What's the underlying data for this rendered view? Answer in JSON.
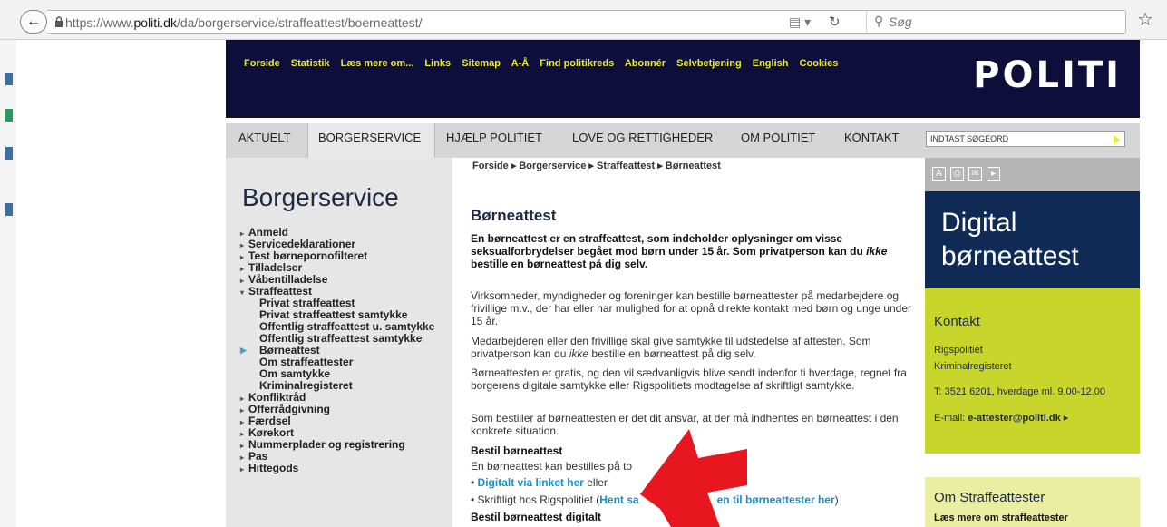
{
  "browser": {
    "url_prefix": "https://www.",
    "url_domain": "politi.dk",
    "url_path": "/da/borgerservice/straffeattest/boerneattest/",
    "search_placeholder": "Søg"
  },
  "header": {
    "topnav": [
      "Forside",
      "Statistik",
      "Læs mere om...",
      "Links",
      "Sitemap",
      "A-Å",
      "Find politikreds",
      "Abonnér",
      "Selvbetjening",
      "English",
      "Cookies"
    ],
    "logo": "POLITI"
  },
  "mainnav": {
    "items": [
      "AKTUELT",
      "BORGERSERVICE",
      "HJÆLP POLITIET",
      "LOVE OG RETTIGHEDER",
      "OM POLITIET",
      "KONTAKT"
    ],
    "search_placeholder": "INDTAST SØGEORD"
  },
  "sidebar": {
    "title": "Borgerservice",
    "items": [
      "Anmeld",
      "Servicedeklarationer",
      "Test børnepornofilteret",
      "Tilladelser",
      "Våbentilladelse",
      "Straffeattest"
    ],
    "subitems": [
      "Privat straffeattest",
      "Privat straffeattest samtykke",
      "Offentlig straffeattest u. samtykke",
      "Offentlig straffeattest samtykke",
      "Børneattest",
      "Om straffeattester",
      "Om samtykke",
      "Kriminalregisteret"
    ],
    "items_after": [
      "Konfliktråd",
      "Offerrådgivning",
      "Færdsel",
      "Kørekort",
      "Nummerplader og registrering",
      "Pas",
      "Hittegods"
    ]
  },
  "content": {
    "breadcrumb": "Forside ▸ Borgerservice ▸ Straffeattest ▸ Børneattest",
    "title": "Børneattest",
    "intro_1": "En børneattest er en straffeattest, som indeholder oplysninger om visse seksualforbrydelser begået mod børn under 15 år. Som privatperson kan du ",
    "intro_em": "ikke",
    "intro_2": " bestille en børneattest på dig selv.",
    "para1": "Virksomheder, myndigheder og foreninger kan bestille børneattester på medarbejdere og frivillige m.v., der har eller har mulighed for at opnå direkte kontakt med børn og unge under 15 år.",
    "para2_1": "Medarbejderen eller den frivillige skal give samtykke til udstedelse af attesten. Som privatperson kan du ",
    "para2_em": "ikke",
    "para2_2": " bestille en børneattest på dig selv.",
    "para3": "Børneattesten er gratis, og den vil sædvanligvis blive sendt indenfor ti hverdage, regnet fra borgerens digitale samtykke eller Rigspolitiets modtagelse af skriftligt samtykke.",
    "para4": "Som bestiller af børneattesten er det dit ansvar, at der må indhentes en børneattest i den konkrete situation.",
    "subhead1": "Bestil børneattest",
    "para5": "En børneattest kan bestilles på to",
    "bullet1_link": "Digitalt via linket her",
    "bullet1_rest": " eller",
    "bullet2_pre": "• Skriftligt hos Rigspolitiet (",
    "bullet2_link1": "Hent sa",
    "bullet2_link2": "en til børneattester her",
    "bullet2_post": ")",
    "subhead2": "Bestil børneattest digitalt"
  },
  "right": {
    "promo_line1": "Digital",
    "promo_line2": "børneattest",
    "contact_title": "Kontakt",
    "contact_org1": "Rigspolitiet",
    "contact_org2": "Kriminalregisteret",
    "contact_phone": "T: 3521 6201, hverdage ml. 9.00-12.00",
    "contact_email_label": "E-mail: ",
    "contact_email": "e-attester@politi.dk",
    "om_title": "Om Straffeattester",
    "om_link": "Læs mere om straffeattester"
  },
  "colors": {
    "header_bg": "#0e0e3a",
    "nav_yellow": "#e8e83a",
    "contact_green": "#c8d62b",
    "promo_blue": "#0e2a55",
    "link_blue": "#1a8fc7",
    "arrow_red": "#e8161e"
  }
}
